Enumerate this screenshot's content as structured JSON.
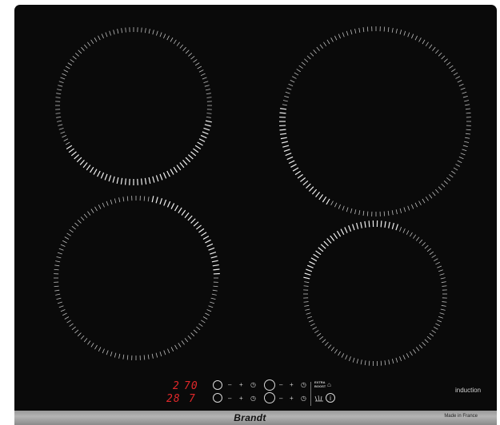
{
  "brand": "Brandt",
  "footer_note": "Made in France",
  "hob_label": "induction",
  "displays": {
    "top_left": "2",
    "top_mid": "70",
    "bottom_left": "28",
    "bottom_mid": "7"
  },
  "controls": {
    "minus": "–",
    "plus": "+",
    "timer": "◷",
    "extra_line1": "EXTRA",
    "extra_line2": "BOOST",
    "lock": "⌂",
    "power": "i"
  },
  "colors": {
    "glass": "#0a0a0a",
    "display_red": "#e0282a",
    "marking": "#d8d8d8",
    "frame": "#a0a0a0"
  }
}
